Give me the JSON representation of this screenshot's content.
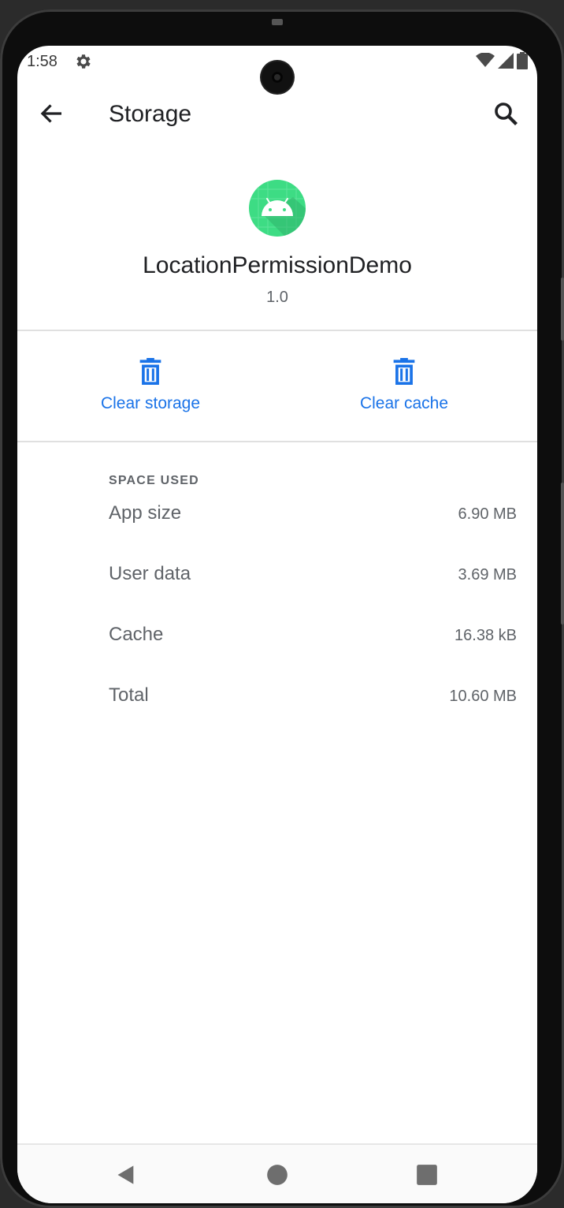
{
  "status_bar": {
    "time": "1:58",
    "icons": [
      "gear-icon",
      "wifi-icon",
      "signal-icon",
      "battery-icon"
    ]
  },
  "toolbar": {
    "title": "Storage",
    "back_icon": "arrow-back-icon",
    "search_icon": "search-icon"
  },
  "app": {
    "name": "LocationPermissionDemo",
    "version": "1.0",
    "icon": "android-icon",
    "icon_color": "#3ddc84"
  },
  "actions": [
    {
      "label": "Clear storage",
      "icon": "trash-icon"
    },
    {
      "label": "Clear cache",
      "icon": "trash-icon"
    }
  ],
  "accent_color": "#1a73e8",
  "space_used": {
    "header": "SPACE USED",
    "rows": [
      {
        "label": "App size",
        "value": "6.90 MB"
      },
      {
        "label": "User data",
        "value": "3.69 MB"
      },
      {
        "label": "Cache",
        "value": "16.38 kB"
      },
      {
        "label": "Total",
        "value": "10.60 MB"
      }
    ]
  },
  "nav_bar": {
    "buttons": [
      "back-triangle-icon",
      "home-circle-icon",
      "recents-square-icon"
    ]
  }
}
